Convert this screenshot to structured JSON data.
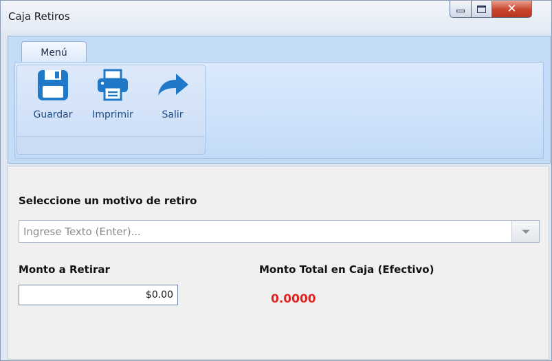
{
  "window": {
    "title": "Caja Retiros"
  },
  "ribbon": {
    "tab_label": "Menú",
    "buttons": [
      {
        "label": "Guardar",
        "icon": "save-icon"
      },
      {
        "label": "Imprimir",
        "icon": "printer-icon"
      },
      {
        "label": "Salir",
        "icon": "exit-arrow-icon"
      }
    ]
  },
  "form": {
    "motivo_label": "Seleccione un motivo de retiro",
    "motivo_placeholder": "Ingrese Texto (Enter)...",
    "monto_label": "Monto a Retirar",
    "monto_value": "$0.00",
    "total_label": "Monto Total en Caja (Efectivo)",
    "total_value": "0.0000"
  },
  "colors": {
    "accent_blue": "#1f78c8",
    "total_red": "#e0241f"
  }
}
